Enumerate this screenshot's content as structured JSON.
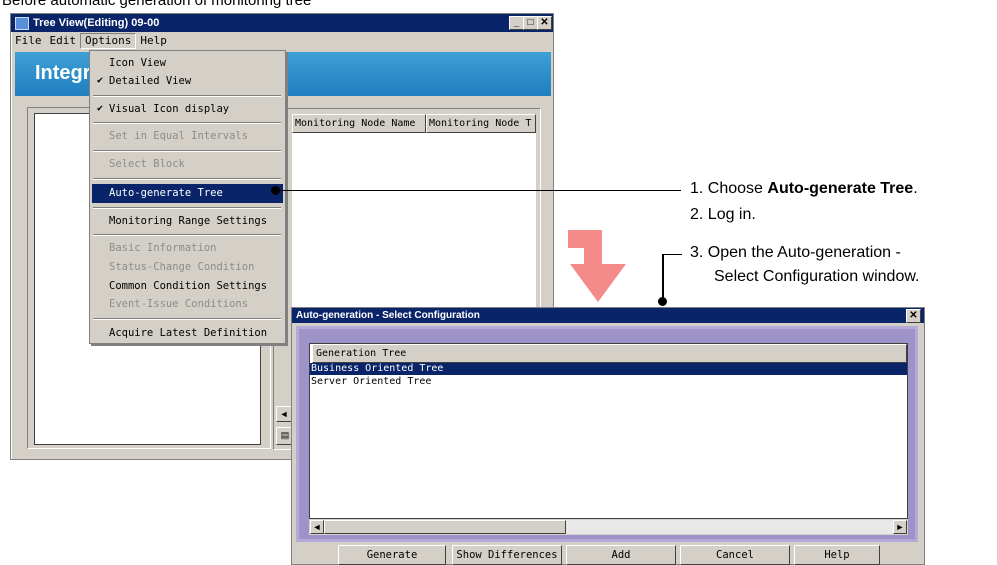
{
  "caption": "Before automatic generation of monitoring tree",
  "treeview": {
    "title": "Tree View(Editing) 09-00",
    "window_buttons": [
      "_",
      "□",
      "✕"
    ],
    "menubar": [
      "File",
      "Edit",
      "Options",
      "Help"
    ],
    "banner": "Integra",
    "columns": [
      "Monitoring Node Name",
      "Monitoring Node T"
    ]
  },
  "options_menu": {
    "checkmark": "✔",
    "items": [
      {
        "label": "Icon View",
        "checked": false,
        "disabled": false
      },
      {
        "label": "Detailed View",
        "checked": true,
        "disabled": false
      },
      {
        "label": "Visual Icon display",
        "checked": true,
        "disabled": false
      },
      {
        "label": "Set in Equal Intervals",
        "checked": false,
        "disabled": true
      },
      {
        "label": "Select Block",
        "checked": false,
        "disabled": true
      },
      {
        "label": "Auto-generate Tree",
        "checked": false,
        "disabled": false,
        "selected": true
      },
      {
        "label": "Monitoring Range Settings",
        "checked": false,
        "disabled": false
      },
      {
        "label": "Basic Information",
        "checked": false,
        "disabled": true
      },
      {
        "label": "Status-Change Condition",
        "checked": false,
        "disabled": true
      },
      {
        "label": "Common Condition Settings",
        "checked": false,
        "disabled": false
      },
      {
        "label": "Event-Issue Conditions",
        "checked": false,
        "disabled": true
      },
      {
        "label": "Acquire Latest Definition",
        "checked": false,
        "disabled": false
      }
    ]
  },
  "annotations": {
    "step1_prefix": "1. Choose ",
    "step1_bold": "Auto-generate Tree",
    "step1_suffix": ".",
    "step2": "2. Log in.",
    "step3_line1": "3. Open the Auto-generation -",
    "step3_line2": "Select Configuration window."
  },
  "autogen": {
    "title": "Auto-generation - Select Configuration",
    "close": "✕",
    "list_header": "Generation Tree",
    "rows": [
      {
        "label": "Business Oriented Tree",
        "selected": true
      },
      {
        "label": "Server Oriented Tree",
        "selected": false
      }
    ],
    "buttons": [
      "Generate",
      "Show Differences",
      "Add",
      "Cancel",
      "Help"
    ]
  },
  "colors": {
    "arrow": "#f58a8a",
    "titlebar": "#0a246a",
    "banner": "#2a8ccb",
    "frame": "#9d93c8"
  }
}
